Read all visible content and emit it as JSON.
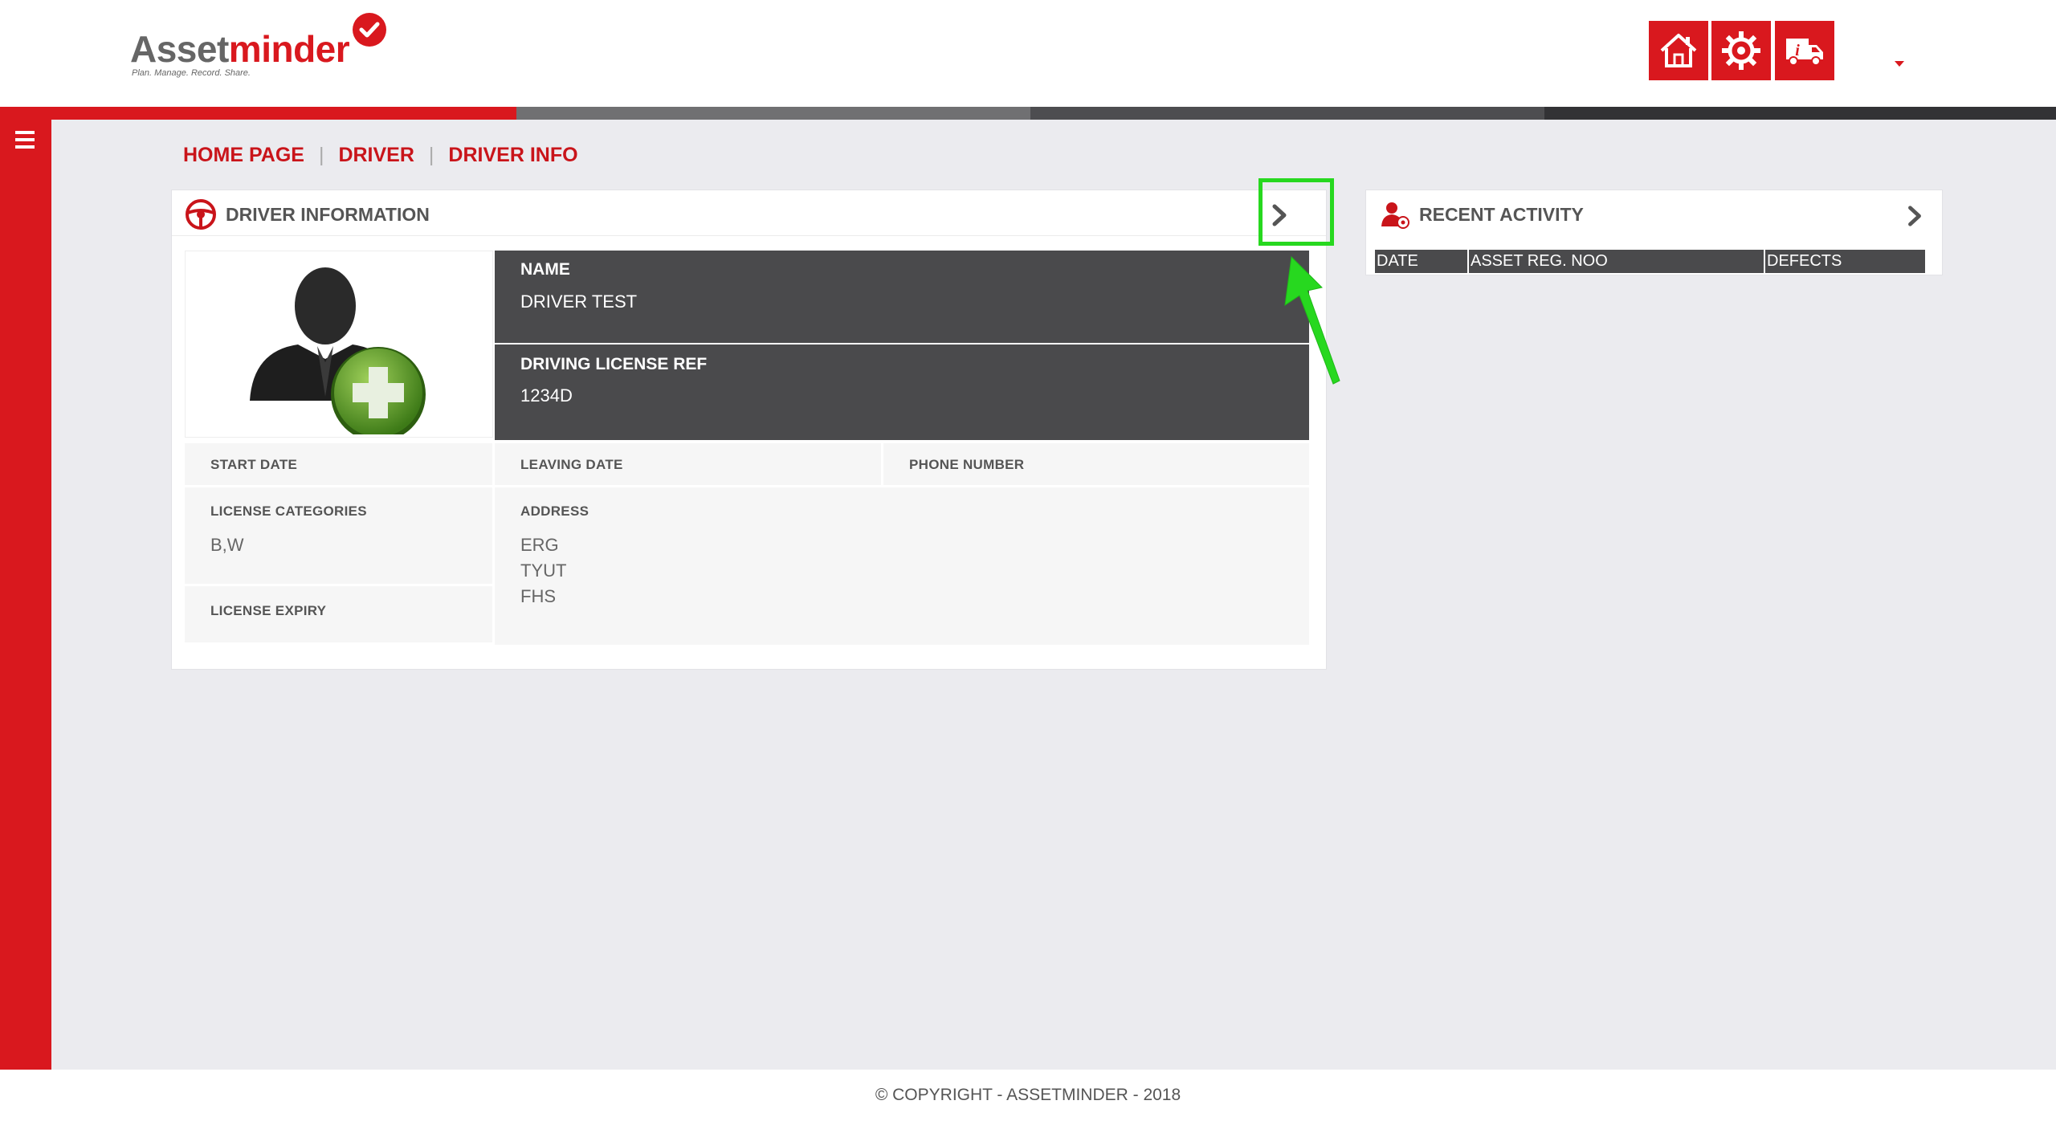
{
  "app": {
    "logo_main": "Asset",
    "logo_accent": "minder",
    "tagline": "Plan. Manage. Record. Share."
  },
  "header": {
    "buttons": [
      {
        "icon": "home-icon"
      },
      {
        "icon": "gear-icon"
      },
      {
        "icon": "truck-info-icon"
      }
    ]
  },
  "colors": {
    "brand_red": "#d9181e",
    "dark_panel": "#4a4a4c",
    "highlight_green": "#27d81f"
  },
  "breadcrumb": {
    "items": [
      "HOME PAGE",
      "DRIVER",
      "DRIVER INFO"
    ],
    "separator": "|"
  },
  "driver_panel": {
    "title": "DRIVER INFORMATION",
    "name_label": "NAME",
    "name_value": "DRIVER TEST",
    "license_ref_label": "DRIVING LICENSE REF",
    "license_ref_value": "1234D",
    "start_date_label": "START DATE",
    "leaving_date_label": "LEAVING DATE",
    "phone_label": "PHONE NUMBER",
    "license_categories_label": "LICENSE CATEGORIES",
    "license_categories_value": "B,W",
    "license_expiry_label": "LICENSE EXPIRY",
    "address_label": "ADDRESS",
    "address_lines": [
      "ERG",
      "TYUT",
      "FHS"
    ]
  },
  "activity_panel": {
    "title": "RECENT ACTIVITY",
    "columns": [
      "DATE",
      "ASSET REG. NOO",
      "DEFECTS"
    ]
  },
  "footer": {
    "text": "© COPYRIGHT - ASSETMINDER - 2018"
  }
}
